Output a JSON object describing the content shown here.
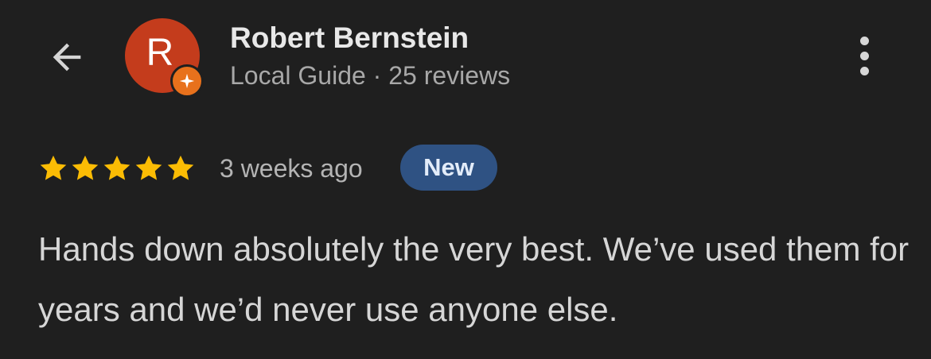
{
  "reviewer": {
    "name": "Robert Bernstein",
    "avatar_letter": "R",
    "level": "Local Guide",
    "separator": "·",
    "review_count": "25 reviews",
    "avatar_color": "#c43c1c",
    "badge_color": "#e8711c"
  },
  "review": {
    "rating": 5,
    "max_rating": 5,
    "time": "3 weeks ago",
    "badge": "New",
    "text": "Hands down absolutely the very best. We’ve used them for years and we’d never use anyone else."
  },
  "icons": {
    "back": "arrow-back-icon",
    "more": "more-vert-icon",
    "star": "star-icon",
    "guide": "local-guide-badge-icon"
  },
  "colors": {
    "background": "#1f1f1f",
    "star": "#fbbc04",
    "new_badge": "#2f5283"
  }
}
